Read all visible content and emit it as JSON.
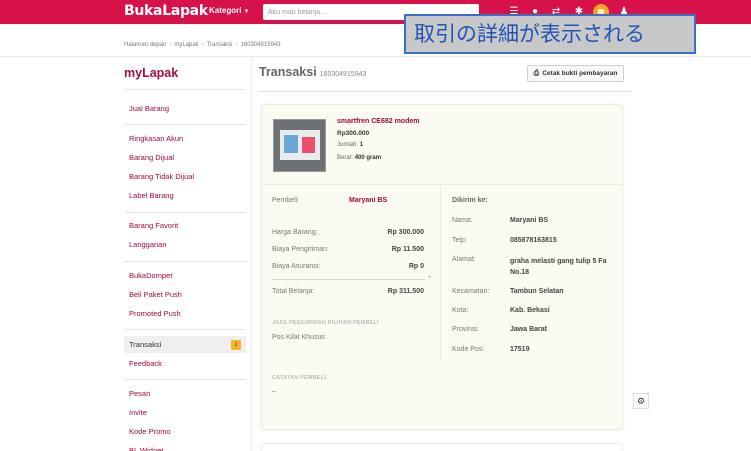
{
  "header": {
    "logo": "BukaLapak",
    "kategori": "Kategori",
    "search_placeholder": "Aku mau belanja...",
    "icons": [
      "list-icon",
      "bell-icon",
      "exchange-icon",
      "gear-icon",
      "shop-icon",
      "user-icon"
    ]
  },
  "caption": "取引の詳細が表示される",
  "breadcrumb": [
    "Halaman depan",
    "myLapak",
    "Transaksi",
    "160304915943"
  ],
  "sidebar": {
    "title": "myLapak",
    "items": [
      {
        "label": "Jual Barang"
      },
      {
        "label": "Ringkasan Akun"
      },
      {
        "label": "Barang Dijual"
      },
      {
        "label": "Barang Tidak Dijual"
      },
      {
        "label": "Label Barang"
      },
      {
        "label": "Barang Favorit"
      },
      {
        "label": "Langganan"
      },
      {
        "label": "BukaDompet"
      },
      {
        "label": "Beli Paket Push"
      },
      {
        "label": "Promoted Push"
      },
      {
        "label": "Transaksi",
        "badge": "1"
      },
      {
        "label": "Feedback"
      },
      {
        "label": "Pesan"
      },
      {
        "label": "Invite"
      },
      {
        "label": "Kode Promo"
      },
      {
        "label": "BL Widget"
      }
    ]
  },
  "main": {
    "title": "Transaksi",
    "transaction_id": "160304915943",
    "print_button": "Cetak bukti pembayaran"
  },
  "product": {
    "name": "smartfren CE682 modem",
    "price": "Rp300.000",
    "qty_label": "Jumlah:",
    "qty": "1",
    "weight_label": "Berat:",
    "weight": "400 gram"
  },
  "payment": {
    "buyer_label": "Pembeli:",
    "buyer": "Maryani BS",
    "harga_label": "Harga Barang:",
    "harga": "Rp 300.000",
    "kirim_label": "Biaya Pengiriman:",
    "kirim": "Rp 11.500",
    "asuransi_label": "Biaya Asuransi:",
    "asuransi": "Rp 0",
    "total_label": "Total Belanja:",
    "total": "Rp 311.500",
    "jasa_head": "JASA PENGIRIMAN PILIHAN PEMBELI",
    "jasa": "Pos Kilat Khusus",
    "catatan_head": "CATATAN PEMBELI",
    "catatan": "–"
  },
  "shipping": {
    "head": "Dikirim ke:",
    "nama_label": "Nama:",
    "nama": "Maryani BS",
    "telp_label": "Telp:",
    "telp": "085878163815",
    "alamat_label": "Alamat:",
    "alamat": "graha melasti gang tulip 5 Fa No.18",
    "kecamatan_label": "Kecamatan:",
    "kecamatan": "Tambun Selatan",
    "kota_label": "Kota:",
    "kota": "Kab. Bekasi",
    "provinsi_label": "Provinsi:",
    "provinsi": "Jawa Barat",
    "kodepos_label": "Kode Pos:",
    "kodepos": "17519"
  }
}
